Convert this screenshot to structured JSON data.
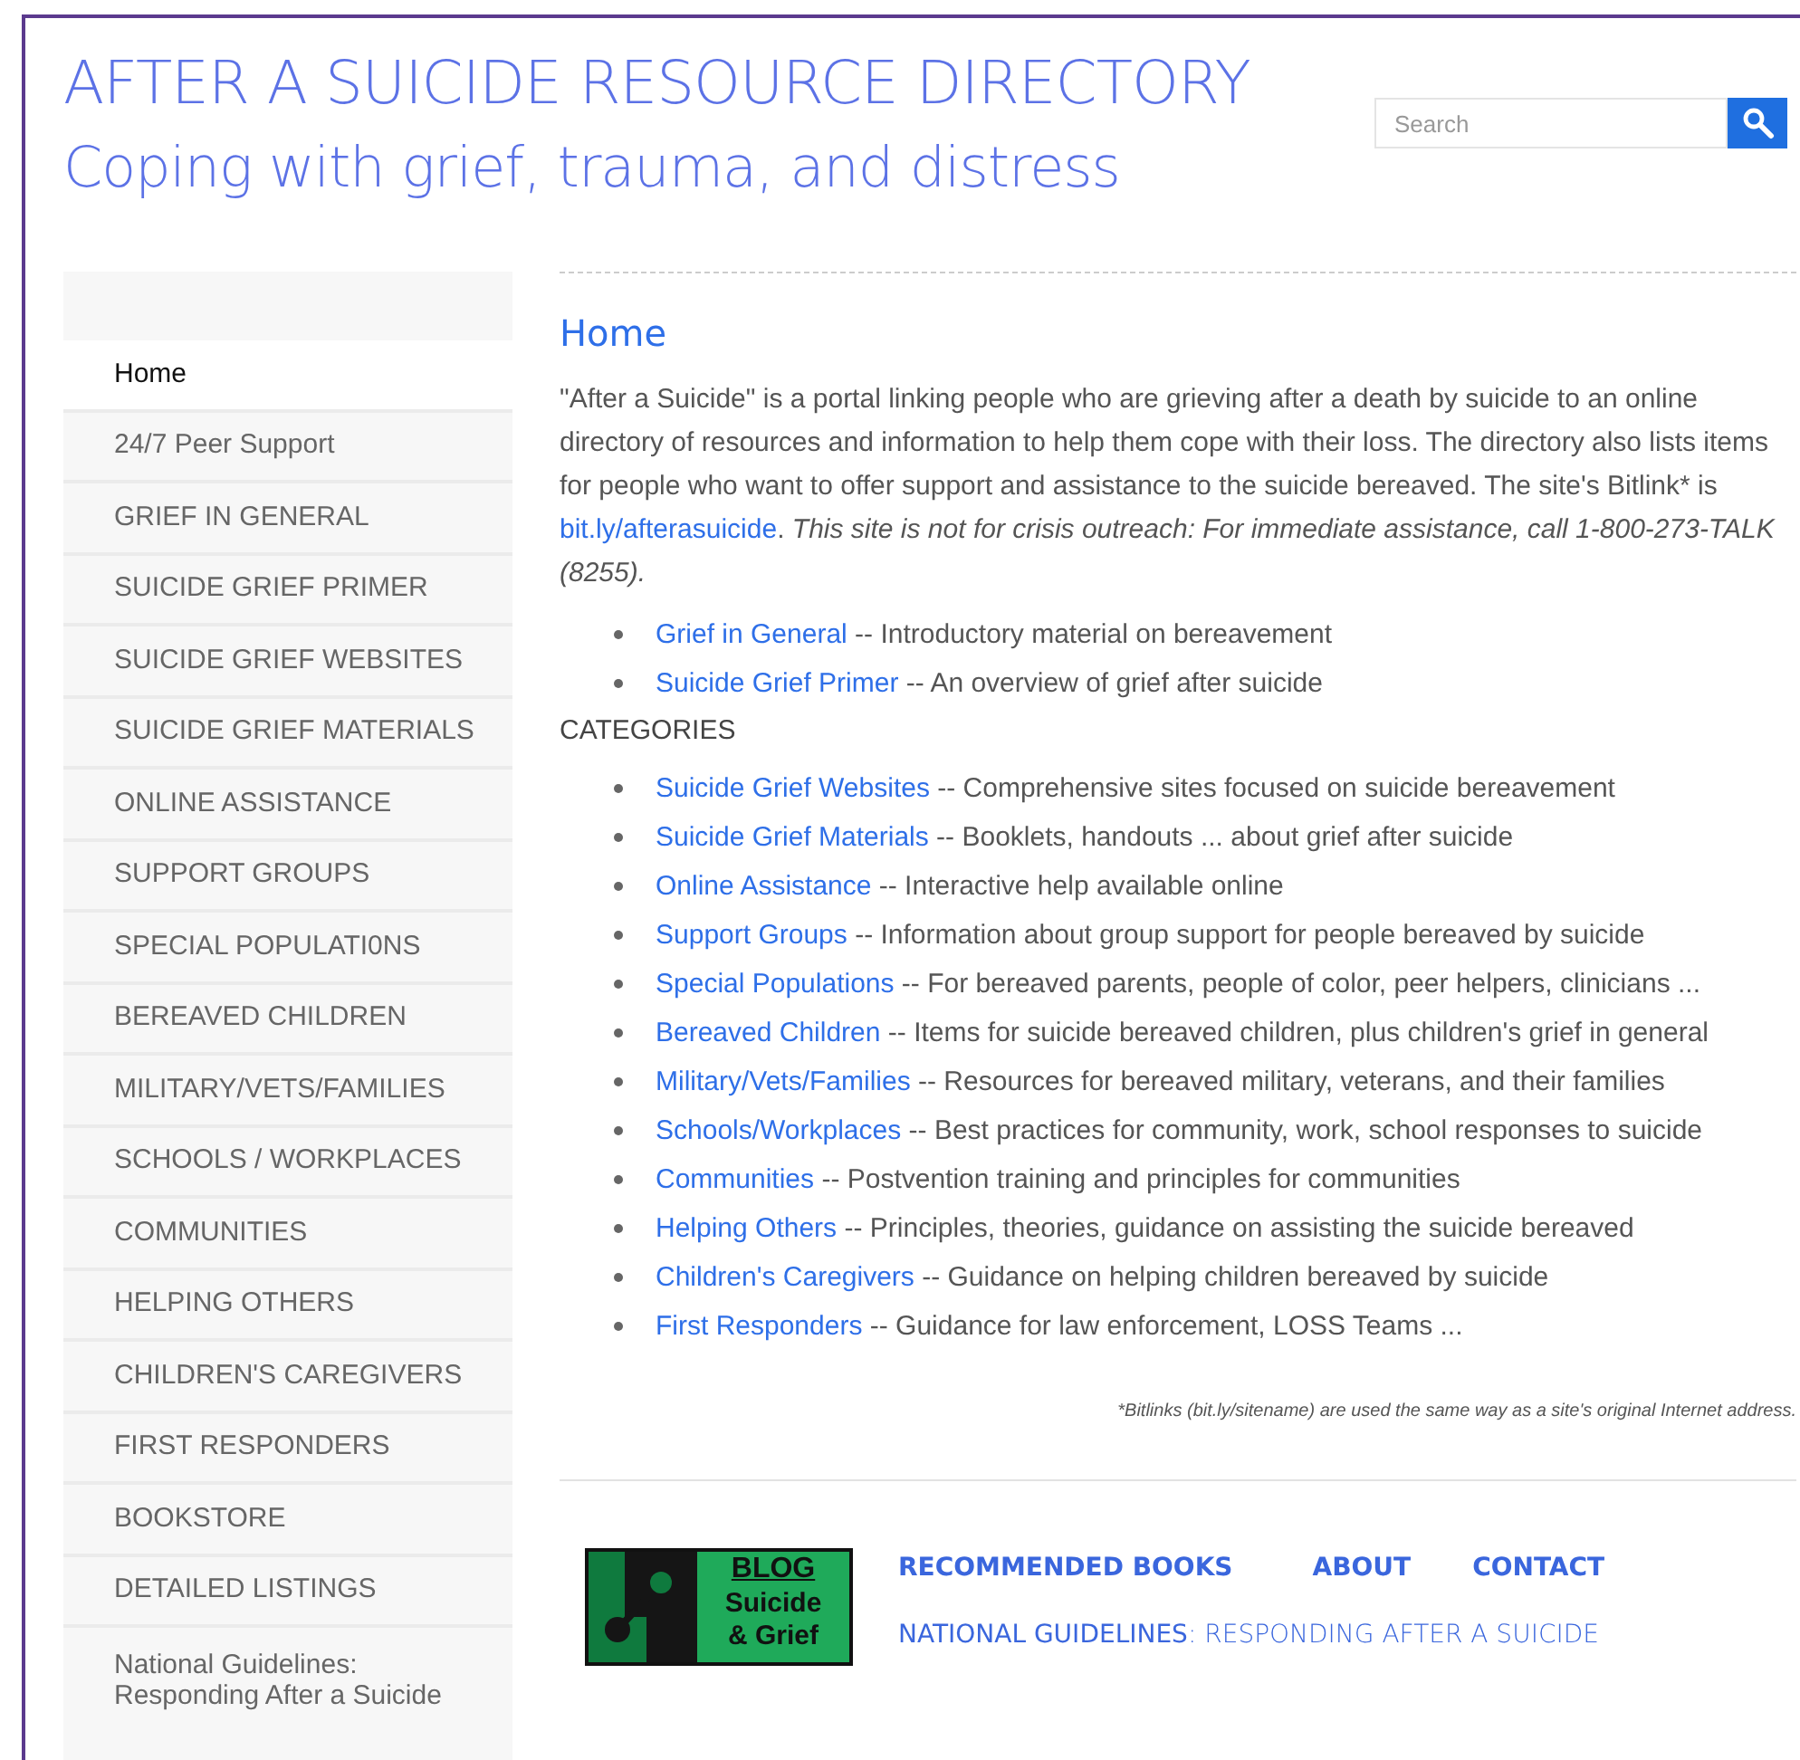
{
  "header": {
    "title": "AFTER A SUICIDE RESOURCE DIRECTORY",
    "subtitle": "Coping with grief, trauma, and distress",
    "search": {
      "placeholder": "Search"
    }
  },
  "sidebar": {
    "items": [
      {
        "label": "Home",
        "selected": true
      },
      {
        "label": "24/7 Peer Support",
        "selected": false
      },
      {
        "label": "GRIEF IN GENERAL",
        "selected": false
      },
      {
        "label": "SUICIDE GRIEF PRIMER",
        "selected": false
      },
      {
        "label": "SUICIDE GRIEF WEBSITES",
        "selected": false
      },
      {
        "label": "SUICIDE GRIEF MATERIALS",
        "selected": false
      },
      {
        "label": "ONLINE ASSISTANCE",
        "selected": false
      },
      {
        "label": "SUPPORT GROUPS",
        "selected": false
      },
      {
        "label": "SPECIAL POPULATI0NS",
        "selected": false
      },
      {
        "label": "BEREAVED CHILDREN",
        "selected": false
      },
      {
        "label": "MILITARY/VETS/FAMILIES",
        "selected": false
      },
      {
        "label": "SCHOOLS / WORKPLACES",
        "selected": false
      },
      {
        "label": "COMMUNITIES",
        "selected": false
      },
      {
        "label": "HELPING OTHERS",
        "selected": false
      },
      {
        "label": "CHILDREN'S CAREGIVERS",
        "selected": false
      },
      {
        "label": "FIRST RESPONDERS",
        "selected": false
      },
      {
        "label": "BOOKSTORE",
        "selected": false
      },
      {
        "label": "DETAILED LISTINGS",
        "selected": false
      },
      {
        "label": "National Guidelines: Responding After a Suicide",
        "selected": false
      }
    ]
  },
  "content": {
    "heading": "Home",
    "intro": {
      "text": "\"After a Suicide\" is a portal linking people who are grieving after a death by suicide to an online directory of resources and information to help them cope with their loss.  The directory also lists items for people who want to offer support and assistance to the suicide bereaved. The site's Bitlink* is ",
      "link": "bit.ly/afterasuicide",
      "after": ". ",
      "note": "This site is not for crisis outreach: For immediate assistance, call 1-800-273-TALK (8255)."
    },
    "top_links": [
      {
        "link": "Grief in General",
        "text": " -- Introductory material on bereavement"
      },
      {
        "link": "Suicide Grief Primer",
        "text": " -- An overview of  grief after suicide"
      }
    ],
    "categories_label": "CATEGORIES",
    "categories": [
      {
        "link": "Suicide Grief Websites",
        "text": " -- Comprehensive sites focused on suicide bereavement"
      },
      {
        "link": "Suicide Grief Materials",
        "text": " -- Booklets, handouts ... about grief after suicide"
      },
      {
        "link": "Online Assistance",
        "text": " -- Interactive help available online"
      },
      {
        "link": "Support Groups",
        "text": " -- Information about group support for people bereaved by suicide"
      },
      {
        "link": "Special Populations",
        "text": " -- For bereaved parents, people of color, peer helpers, clinicians ..."
      },
      {
        "link": "Bereaved Children",
        "text": " -- Items for suicide bereaved children, plus children's grief in general"
      },
      {
        "link": "Military/Vets/Families",
        "text": " -- Resources for bereaved military, veterans, and their families"
      },
      {
        "link": "Schools/Workplaces",
        "text": " -- Best practices for community, work, school responses to suicide"
      },
      {
        "link": "Communities",
        "text": " -- Postvention training and principles for communities"
      },
      {
        "link": "Helping Others",
        "text": " -- Principles, theories, guidance on assisting the suicide bereaved"
      },
      {
        "link": "Children's Caregivers",
        "text": " -- Guidance on helping children bereaved by suicide"
      },
      {
        "link": "First Responders",
        "text": " -- Guidance for law enforcement, LOSS Teams ..."
      }
    ],
    "footnote": "*Bitlinks (bit.ly/sitename) are used the same way as a site's original Internet address."
  },
  "footer": {
    "blog_logo": {
      "title": "BLOG",
      "line_1": "Suicide",
      "line_2": "& Grief"
    },
    "links": [
      "RECOMMENDED BOOKS",
      "ABOUT",
      "CONTACT"
    ],
    "guidelines_link": "**NATIONAL GUIDELINES**: RESPONDING AFTER A SUICIDE"
  }
}
